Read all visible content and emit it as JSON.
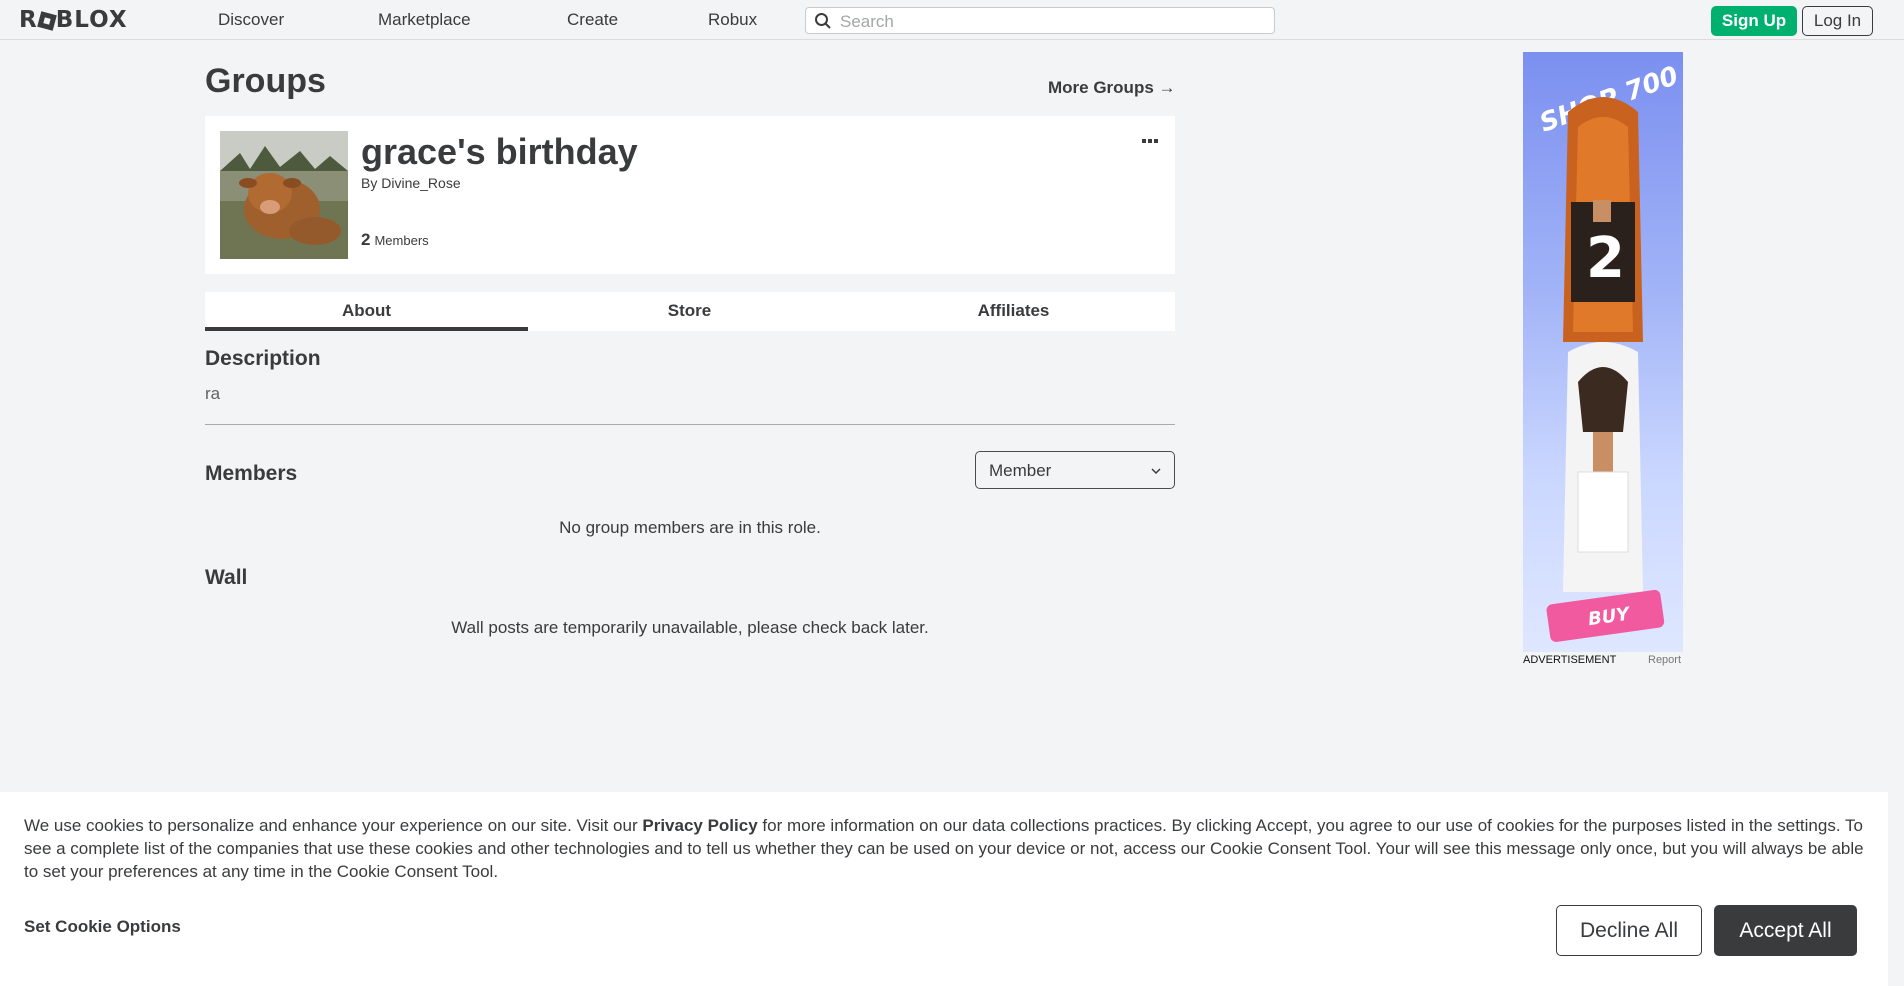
{
  "nav": {
    "logo": "ROBLOX",
    "links": [
      "Discover",
      "Marketplace",
      "Create",
      "Robux"
    ],
    "search_placeholder": "Search",
    "signup_label": "Sign Up",
    "login_label": "Log In"
  },
  "page": {
    "title": "Groups",
    "more_groups": "More Groups →"
  },
  "group": {
    "name": "grace's birthday",
    "by_label": "By",
    "owner": "Divine_Rose",
    "member_count": "2",
    "members_label": "Members",
    "more_icon": "ellipsis-icon"
  },
  "tabs": [
    "About",
    "Store",
    "Affiliates"
  ],
  "about": {
    "description_title": "Description",
    "description": "ra",
    "members_title": "Members",
    "role_selected": "Member",
    "members_empty": "No group members are in this role.",
    "wall_title": "Wall",
    "wall_empty": "Wall posts are temporarily unavailable, please check back later."
  },
  "ad": {
    "caption": "ADVERTISEMENT",
    "report": "Report",
    "shop_text": "SHOP 700",
    "buy_text": "BUY"
  },
  "cookie": {
    "text_before": "We use cookies to personalize and enhance your experience on our site. Visit our ",
    "privacy_link": "Privacy Policy",
    "text_after": " for more information on our data collections practices. By clicking Accept, you agree to our use of cookies for the purposes listed in the settings. To see a complete list of the companies that use these cookies and other technologies and to tell us whether they can be used on your device or not, access our Cookie Consent Tool. Your will see this message only once, but you will always be able to set your preferences at any time in the Cookie Consent Tool.",
    "options_label": "Set Cookie Options",
    "decline_label": "Decline All",
    "accept_label": "Accept All"
  },
  "colors": {
    "signup_green": "#00b06f",
    "text_dark": "#393b3d",
    "background": "#f2f4f5"
  }
}
